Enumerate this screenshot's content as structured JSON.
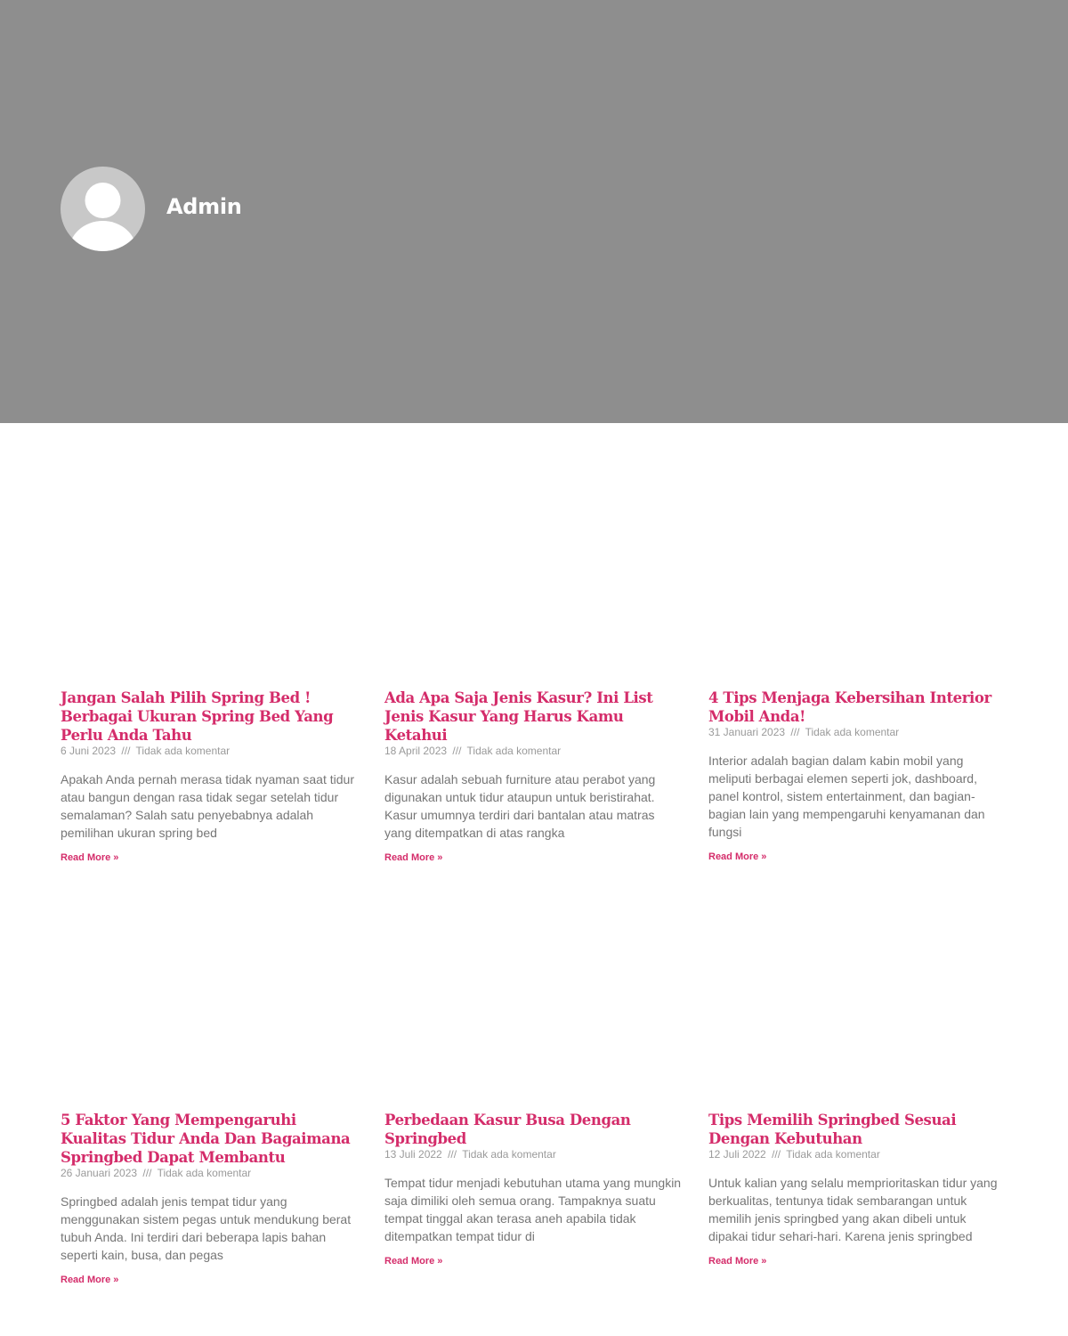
{
  "author": {
    "name": "Admin",
    "avatar_icon": "user-silhouette-icon"
  },
  "colors": {
    "hero_bg": "#8e8e8e",
    "accent": "#d42c6a",
    "meta": "#9a9a9a",
    "body_text": "#767676"
  },
  "posts": [
    {
      "title": "Jangan Salah Pilih Spring Bed ! Berbagai Ukuran Spring Bed Yang Perlu Anda Tahu",
      "date": "6 Juni 2023",
      "separator": "///",
      "comments": "Tidak ada komentar",
      "excerpt": "Apakah Anda pernah merasa tidak nyaman saat tidur atau bangun dengan rasa tidak segar setelah tidur semalaman? Salah satu penyebabnya adalah pemilihan ukuran spring bed",
      "read_more": "Read More »"
    },
    {
      "title": "Ada Apa Saja Jenis Kasur? Ini List Jenis Kasur Yang Harus Kamu Ketahui",
      "date": "18 April 2023",
      "separator": "///",
      "comments": "Tidak ada komentar",
      "excerpt": "Kasur adalah sebuah furniture atau perabot yang digunakan untuk tidur ataupun untuk beristirahat. Kasur umumnya terdiri dari bantalan atau matras yang ditempatkan di atas rangka",
      "read_more": "Read More »"
    },
    {
      "title": "4 Tips Menjaga Kebersihan Interior Mobil Anda!",
      "date": "31 Januari 2023",
      "separator": "///",
      "comments": "Tidak ada komentar",
      "excerpt": "Interior adalah bagian dalam kabin mobil yang meliputi berbagai elemen seperti jok, dashboard, panel kontrol, sistem entertainment, dan bagian-bagian lain yang mempengaruhi kenyamanan dan fungsi",
      "read_more": "Read More »"
    },
    {
      "title": "5 Faktor Yang Mempengaruhi Kualitas Tidur Anda Dan Bagaimana Springbed Dapat Membantu",
      "date": "26 Januari 2023",
      "separator": "///",
      "comments": "Tidak ada komentar",
      "excerpt": "Springbed adalah jenis tempat tidur yang menggunakan sistem pegas untuk mendukung berat tubuh Anda. Ini terdiri dari beberapa lapis bahan seperti kain, busa, dan pegas",
      "read_more": "Read More »"
    },
    {
      "title": "Perbedaan Kasur Busa Dengan Springbed",
      "date": "13 Juli 2022",
      "separator": "///",
      "comments": "Tidak ada komentar",
      "excerpt": "Tempat tidur menjadi kebutuhan utama yang mungkin saja dimiliki oleh semua orang. Tampaknya suatu tempat tinggal akan terasa aneh apabila tidak ditempatkan tempat tidur di",
      "read_more": "Read More »"
    },
    {
      "title": "Tips Memilih Springbed Sesuai Dengan Kebutuhan",
      "date": "12 Juli 2022",
      "separator": "///",
      "comments": "Tidak ada komentar",
      "excerpt": "Untuk kalian yang selalu memprioritaskan tidur yang berkualitas, tentunya tidak sembarangan untuk memilih jenis springbed yang akan dibeli untuk dipakai tidur sehari-hari. Karena jenis springbed",
      "read_more": "Read More »"
    }
  ]
}
